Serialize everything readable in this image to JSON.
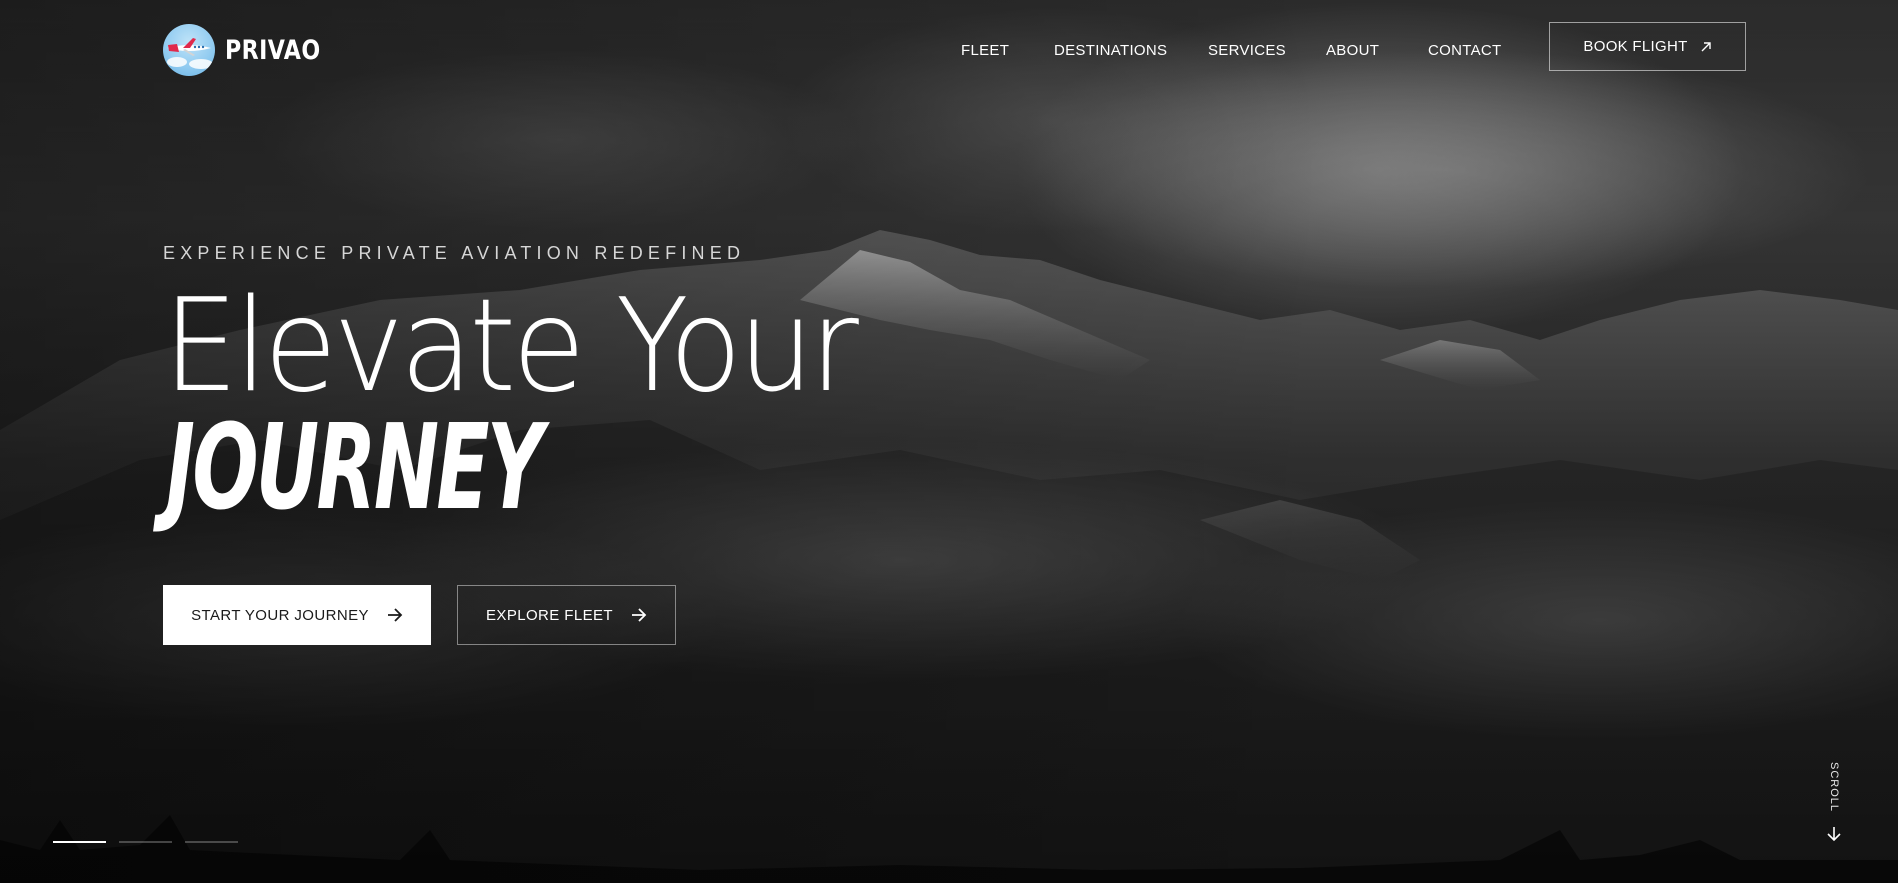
{
  "brand": {
    "name": "PRIVAO"
  },
  "nav": {
    "items": [
      {
        "label": "FLEET"
      },
      {
        "label": "DESTINATIONS"
      },
      {
        "label": "SERVICES"
      },
      {
        "label": "ABOUT"
      },
      {
        "label": "CONTACT"
      }
    ],
    "cta_label": "BOOK FLIGHT"
  },
  "hero": {
    "eyebrow": "EXPERIENCE PRIVATE AVIATION REDEFINED",
    "title_line1": "Elevate Your",
    "title_line2": "JOURNEY",
    "primary_button": "START YOUR JOURNEY",
    "secondary_button": "EXPLORE FLEET"
  },
  "slides": {
    "count": 3,
    "active_index": 0
  },
  "scroll": {
    "label": "SCROLL"
  },
  "colors": {
    "background": "#2b2b2b",
    "text": "#ffffff",
    "primary_button_bg": "#ffffff",
    "primary_button_text": "#1a1a1a",
    "logo_circle": "#8fcaf0",
    "logo_plane_accent": "#e0294b"
  },
  "icons": {
    "book_arrow": "arrow-up-right-icon",
    "button_arrow": "arrow-right-icon",
    "scroll_arrow": "arrow-down-icon"
  }
}
